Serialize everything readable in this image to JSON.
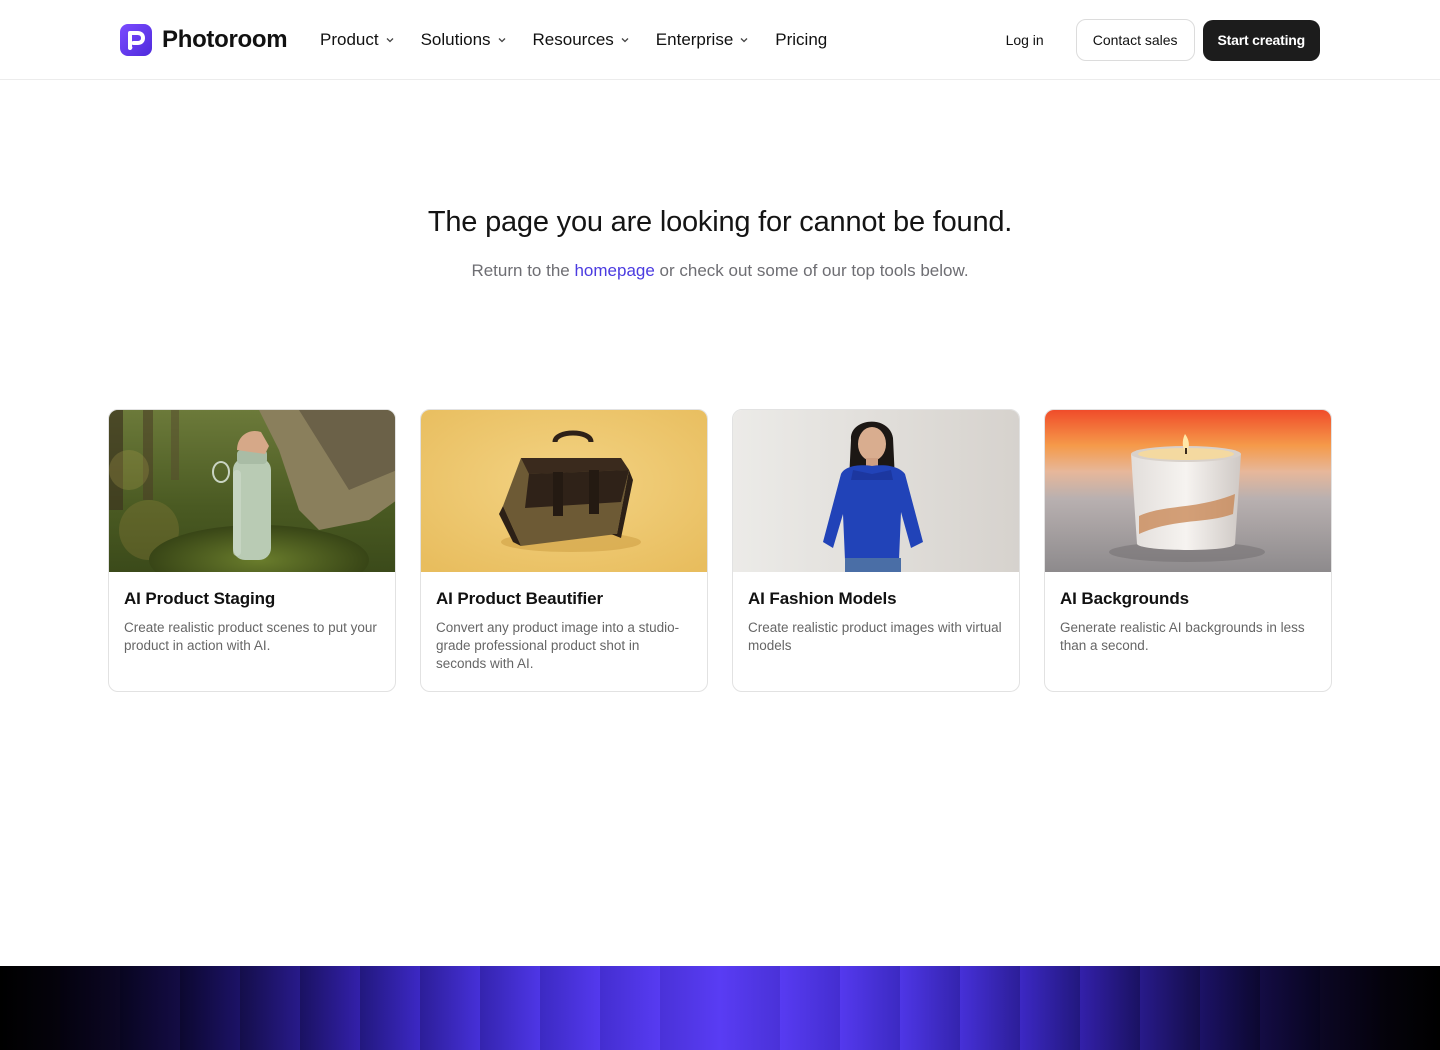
{
  "brand": {
    "name": "Photoroom",
    "accent": "#5b3bf0"
  },
  "nav": {
    "items": [
      {
        "label": "Product",
        "dropdown": true
      },
      {
        "label": "Solutions",
        "dropdown": true
      },
      {
        "label": "Resources",
        "dropdown": true
      },
      {
        "label": "Enterprise",
        "dropdown": true
      },
      {
        "label": "Pricing",
        "dropdown": false
      }
    ],
    "login": "Log in",
    "contact": "Contact sales",
    "cta": "Start creating"
  },
  "hero": {
    "title": "The page you are looking for cannot be found.",
    "pre_link": "Return to the ",
    "link": "homepage",
    "post_link": " or check out some of our top tools below."
  },
  "cards": [
    {
      "title": "AI Product Staging",
      "desc": "Create realistic product scenes to put your product in action with AI.",
      "image": "green-bottle-forest"
    },
    {
      "title": "AI Product Beautifier",
      "desc": "Convert any product image into a studio-grade professional product shot in seconds with AI.",
      "image": "brown-bag-yellow"
    },
    {
      "title": "AI Fashion Models",
      "desc": "Create realistic product images with virtual models",
      "image": "woman-blue-sweater"
    },
    {
      "title": "AI Backgrounds",
      "desc": "Generate realistic AI backgrounds in less than a second.",
      "image": "candle-sunset"
    }
  ]
}
